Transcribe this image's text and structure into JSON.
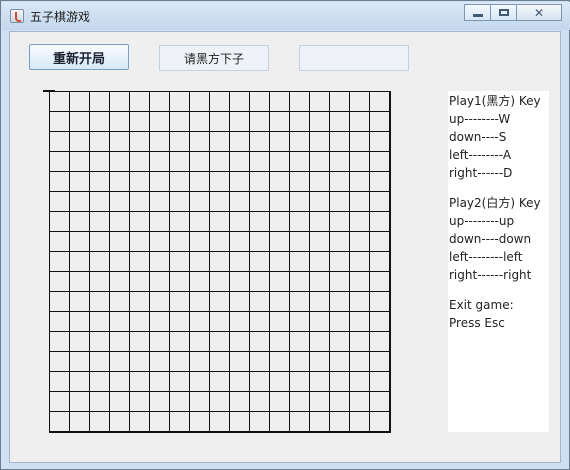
{
  "window": {
    "title": "五子棋游戏"
  },
  "controls": {
    "restart_label": "重新开局",
    "status_text": "请黑方下子",
    "extra_field_text": ""
  },
  "board": {
    "columns": 17,
    "rows": 17
  },
  "help": {
    "player1": {
      "title": "Play1(黑方) Key",
      "up": "up--------W",
      "down": "down----S",
      "left": "left--------A",
      "right": "right------D"
    },
    "player2": {
      "title": "Play2(白方) Key",
      "up": "up--------up",
      "down": "down----down",
      "left": "left--------left",
      "right": "right------right"
    },
    "exit": {
      "title": "Exit game:",
      "key": "Press Esc"
    }
  },
  "icons": {
    "window": "java-cup-icon",
    "minimize": "minimize-icon",
    "maximize": "maximize-icon",
    "close": "close-icon"
  }
}
